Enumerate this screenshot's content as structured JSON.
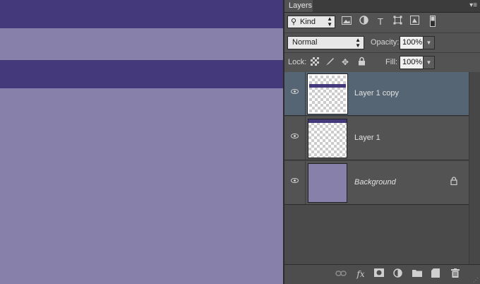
{
  "canvas": {
    "background": "#8780ab",
    "stripe_color": "#44397a"
  },
  "panel": {
    "tab_label": "Layers",
    "menu_icon": "panel-menu-icon",
    "filter": {
      "kind_label": "Kind",
      "icons": [
        "pixel-layer-filter-icon",
        "adjustment-layer-filter-icon",
        "type-layer-filter-icon",
        "shape-layer-filter-icon",
        "smart-object-filter-icon"
      ]
    },
    "blend": {
      "mode": "Normal",
      "opacity_label": "Opacity:",
      "opacity_value": "100%"
    },
    "lock": {
      "label": "Lock:",
      "fill_label": "Fill:",
      "fill_value": "100%",
      "icons": [
        "lock-transparent-pixels-icon",
        "lock-image-pixels-icon",
        "lock-position-icon",
        "lock-all-icon"
      ]
    },
    "layers": [
      {
        "name": "Layer 1 copy",
        "selected": true,
        "visible": true
      },
      {
        "name": "Layer 1",
        "selected": false,
        "visible": true
      },
      {
        "name": "Background",
        "selected": false,
        "visible": true,
        "locked": true
      }
    ],
    "bottom_icons": [
      "link-layers-icon",
      "fx-icon",
      "add-mask-icon",
      "adjustment-layer-icon",
      "new-group-icon",
      "new-layer-icon",
      "delete-layer-icon"
    ],
    "colors": {
      "selected_row": "#566573",
      "panel_bg": "#535353"
    }
  }
}
